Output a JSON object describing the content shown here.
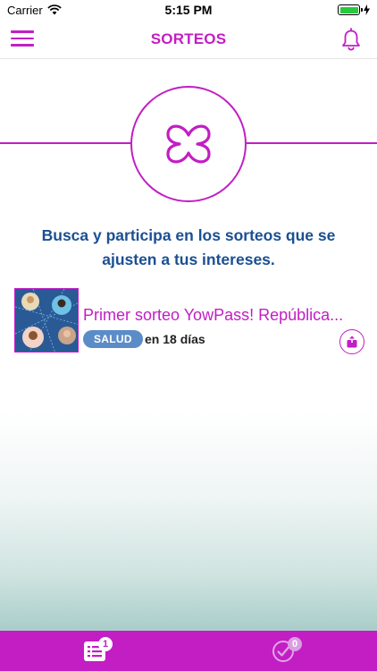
{
  "status_bar": {
    "carrier": "Carrier",
    "time": "5:15 PM"
  },
  "nav": {
    "title": "SORTEOS",
    "menu_icon": "hamburger-menu-icon",
    "bell_icon": "bell-icon"
  },
  "hero": {
    "icon": "clover-logo-icon"
  },
  "tagline": "Busca y participa en los sorteos que se ajusten a tus intereses.",
  "raffles": [
    {
      "title": "Primer sorteo YowPass! República...",
      "badge": "SALUD",
      "time_left": "en 18 días",
      "share_icon": "share-icon"
    }
  ],
  "tabs": [
    {
      "name": "list",
      "icon": "list-icon",
      "badge": "1"
    },
    {
      "name": "done",
      "icon": "check-circle-icon",
      "badge": "0"
    }
  ],
  "colors": {
    "brand": "#c21ec4",
    "tagline": "#1b4f93",
    "badge": "#5b8cc8"
  }
}
